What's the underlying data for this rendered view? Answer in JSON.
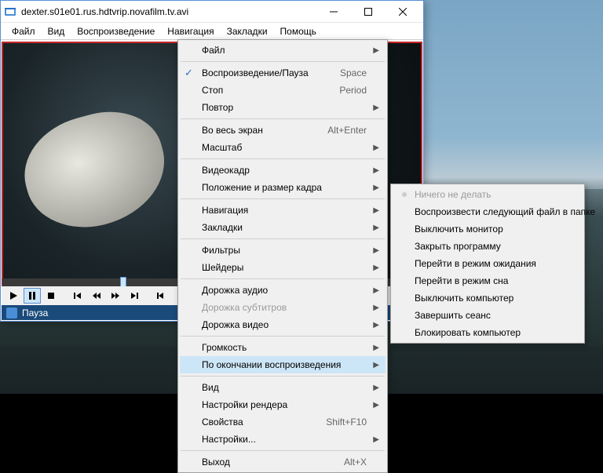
{
  "window": {
    "title": "dexter.s01e01.rus.hdtvrip.novafilm.tv.avi"
  },
  "menubar": {
    "items": [
      "Файл",
      "Вид",
      "Воспроизведение",
      "Навигация",
      "Закладки",
      "Помощь"
    ]
  },
  "status": {
    "text": "Пауза"
  },
  "dropdown1": {
    "groups": [
      [
        {
          "label": "Файл",
          "arrow": true
        }
      ],
      [
        {
          "label": "Воспроизведение/Пауза",
          "shortcut": "Space",
          "checked": true
        },
        {
          "label": "Стоп",
          "shortcut": "Period"
        },
        {
          "label": "Повтор",
          "arrow": true
        }
      ],
      [
        {
          "label": "Во весь экран",
          "shortcut": "Alt+Enter"
        },
        {
          "label": "Масштаб",
          "arrow": true
        }
      ],
      [
        {
          "label": "Видеокадр",
          "arrow": true
        },
        {
          "label": "Положение и размер кадра",
          "arrow": true
        }
      ],
      [
        {
          "label": "Навигация",
          "arrow": true
        },
        {
          "label": "Закладки",
          "arrow": true
        }
      ],
      [
        {
          "label": "Фильтры",
          "arrow": true
        },
        {
          "label": "Шейдеры",
          "arrow": true
        }
      ],
      [
        {
          "label": "Дорожка аудио",
          "arrow": true
        },
        {
          "label": "Дорожка субтитров",
          "arrow": true,
          "disabled": true
        },
        {
          "label": "Дорожка видео",
          "arrow": true
        }
      ],
      [
        {
          "label": "Громкость",
          "arrow": true
        },
        {
          "label": "По окончании воспроизведения",
          "arrow": true,
          "hover": true
        }
      ],
      [
        {
          "label": "Вид",
          "arrow": true
        },
        {
          "label": "Настройки рендера",
          "arrow": true
        },
        {
          "label": "Свойства",
          "shortcut": "Shift+F10"
        },
        {
          "label": "Настройки...",
          "arrow": true
        }
      ],
      [
        {
          "label": "Выход",
          "shortcut": "Alt+X"
        }
      ]
    ]
  },
  "dropdown2": {
    "items": [
      {
        "label": "Ничего не делать",
        "disabled": true,
        "bullet": true
      },
      {
        "label": "Воспроизвести следующий файл в папке"
      },
      {
        "label": "Выключить монитор"
      },
      {
        "label": "Закрыть программу"
      },
      {
        "label": "Перейти в режим ожидания"
      },
      {
        "label": "Перейти в режим сна"
      },
      {
        "label": "Выключить компьютер"
      },
      {
        "label": "Завершить сеанс"
      },
      {
        "label": "Блокировать компьютер"
      }
    ]
  }
}
